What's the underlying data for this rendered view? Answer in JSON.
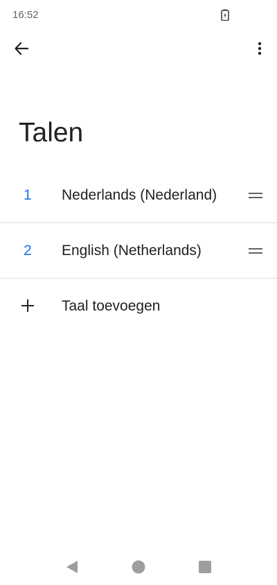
{
  "status_bar": {
    "time": "16:52",
    "battery_icon": "battery-charging-icon"
  },
  "app_bar": {
    "back_icon": "arrow-back-icon",
    "more_icon": "more-vertical-icon"
  },
  "page": {
    "title": "Talen"
  },
  "languages": [
    {
      "number": "1",
      "name": "Nederlands (Nederland)"
    },
    {
      "number": "2",
      "name": "English (Netherlands)"
    }
  ],
  "add_language": {
    "label": "Taal toevoegen",
    "icon": "plus-icon"
  },
  "nav_bar": {
    "back_icon": "nav-back-icon",
    "home_icon": "nav-home-icon",
    "recents_icon": "nav-recents-icon"
  },
  "colors": {
    "accent": "#1a73e8",
    "text": "#202124",
    "divider": "#dadce0",
    "nav": "#9e9e9e"
  }
}
